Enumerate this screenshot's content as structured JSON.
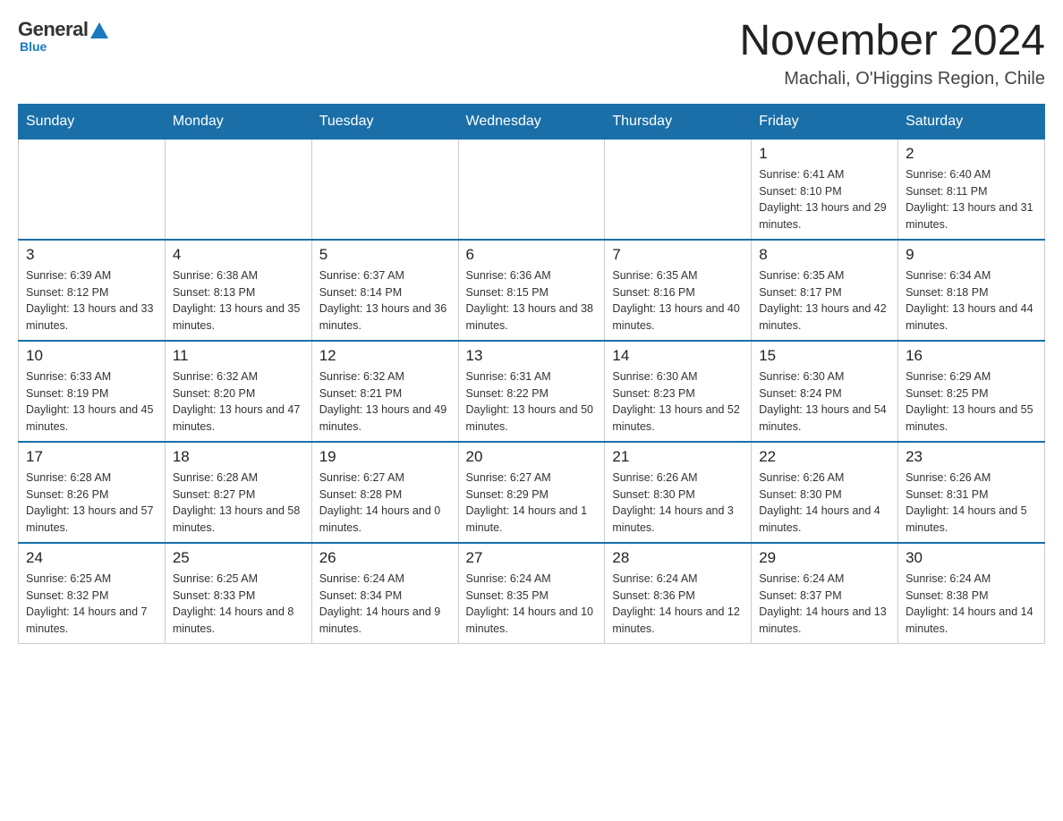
{
  "logo": {
    "general": "General",
    "blue": "Blue"
  },
  "title": "November 2024",
  "subtitle": "Machali, O'Higgins Region, Chile",
  "weekdays": [
    "Sunday",
    "Monday",
    "Tuesday",
    "Wednesday",
    "Thursday",
    "Friday",
    "Saturday"
  ],
  "weeks": [
    [
      {
        "day": "",
        "info": ""
      },
      {
        "day": "",
        "info": ""
      },
      {
        "day": "",
        "info": ""
      },
      {
        "day": "",
        "info": ""
      },
      {
        "day": "",
        "info": ""
      },
      {
        "day": "1",
        "info": "Sunrise: 6:41 AM\nSunset: 8:10 PM\nDaylight: 13 hours and 29 minutes."
      },
      {
        "day": "2",
        "info": "Sunrise: 6:40 AM\nSunset: 8:11 PM\nDaylight: 13 hours and 31 minutes."
      }
    ],
    [
      {
        "day": "3",
        "info": "Sunrise: 6:39 AM\nSunset: 8:12 PM\nDaylight: 13 hours and 33 minutes."
      },
      {
        "day": "4",
        "info": "Sunrise: 6:38 AM\nSunset: 8:13 PM\nDaylight: 13 hours and 35 minutes."
      },
      {
        "day": "5",
        "info": "Sunrise: 6:37 AM\nSunset: 8:14 PM\nDaylight: 13 hours and 36 minutes."
      },
      {
        "day": "6",
        "info": "Sunrise: 6:36 AM\nSunset: 8:15 PM\nDaylight: 13 hours and 38 minutes."
      },
      {
        "day": "7",
        "info": "Sunrise: 6:35 AM\nSunset: 8:16 PM\nDaylight: 13 hours and 40 minutes."
      },
      {
        "day": "8",
        "info": "Sunrise: 6:35 AM\nSunset: 8:17 PM\nDaylight: 13 hours and 42 minutes."
      },
      {
        "day": "9",
        "info": "Sunrise: 6:34 AM\nSunset: 8:18 PM\nDaylight: 13 hours and 44 minutes."
      }
    ],
    [
      {
        "day": "10",
        "info": "Sunrise: 6:33 AM\nSunset: 8:19 PM\nDaylight: 13 hours and 45 minutes."
      },
      {
        "day": "11",
        "info": "Sunrise: 6:32 AM\nSunset: 8:20 PM\nDaylight: 13 hours and 47 minutes."
      },
      {
        "day": "12",
        "info": "Sunrise: 6:32 AM\nSunset: 8:21 PM\nDaylight: 13 hours and 49 minutes."
      },
      {
        "day": "13",
        "info": "Sunrise: 6:31 AM\nSunset: 8:22 PM\nDaylight: 13 hours and 50 minutes."
      },
      {
        "day": "14",
        "info": "Sunrise: 6:30 AM\nSunset: 8:23 PM\nDaylight: 13 hours and 52 minutes."
      },
      {
        "day": "15",
        "info": "Sunrise: 6:30 AM\nSunset: 8:24 PM\nDaylight: 13 hours and 54 minutes."
      },
      {
        "day": "16",
        "info": "Sunrise: 6:29 AM\nSunset: 8:25 PM\nDaylight: 13 hours and 55 minutes."
      }
    ],
    [
      {
        "day": "17",
        "info": "Sunrise: 6:28 AM\nSunset: 8:26 PM\nDaylight: 13 hours and 57 minutes."
      },
      {
        "day": "18",
        "info": "Sunrise: 6:28 AM\nSunset: 8:27 PM\nDaylight: 13 hours and 58 minutes."
      },
      {
        "day": "19",
        "info": "Sunrise: 6:27 AM\nSunset: 8:28 PM\nDaylight: 14 hours and 0 minutes."
      },
      {
        "day": "20",
        "info": "Sunrise: 6:27 AM\nSunset: 8:29 PM\nDaylight: 14 hours and 1 minute."
      },
      {
        "day": "21",
        "info": "Sunrise: 6:26 AM\nSunset: 8:30 PM\nDaylight: 14 hours and 3 minutes."
      },
      {
        "day": "22",
        "info": "Sunrise: 6:26 AM\nSunset: 8:30 PM\nDaylight: 14 hours and 4 minutes."
      },
      {
        "day": "23",
        "info": "Sunrise: 6:26 AM\nSunset: 8:31 PM\nDaylight: 14 hours and 5 minutes."
      }
    ],
    [
      {
        "day": "24",
        "info": "Sunrise: 6:25 AM\nSunset: 8:32 PM\nDaylight: 14 hours and 7 minutes."
      },
      {
        "day": "25",
        "info": "Sunrise: 6:25 AM\nSunset: 8:33 PM\nDaylight: 14 hours and 8 minutes."
      },
      {
        "day": "26",
        "info": "Sunrise: 6:24 AM\nSunset: 8:34 PM\nDaylight: 14 hours and 9 minutes."
      },
      {
        "day": "27",
        "info": "Sunrise: 6:24 AM\nSunset: 8:35 PM\nDaylight: 14 hours and 10 minutes."
      },
      {
        "day": "28",
        "info": "Sunrise: 6:24 AM\nSunset: 8:36 PM\nDaylight: 14 hours and 12 minutes."
      },
      {
        "day": "29",
        "info": "Sunrise: 6:24 AM\nSunset: 8:37 PM\nDaylight: 14 hours and 13 minutes."
      },
      {
        "day": "30",
        "info": "Sunrise: 6:24 AM\nSunset: 8:38 PM\nDaylight: 14 hours and 14 minutes."
      }
    ]
  ]
}
